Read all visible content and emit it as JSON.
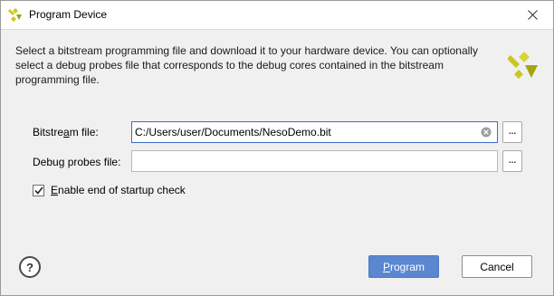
{
  "window": {
    "title": "Program Device",
    "brand_color": "#c8c81e"
  },
  "description": "Select a bitstream programming file and download it to your hardware device. You can optionally select a debug probes file that corresponds to the debug cores contained in the bitstream programming file.",
  "form": {
    "bitstream_label_pre": "Bitstre",
    "bitstream_label_mn": "a",
    "bitstream_label_post": "m file:",
    "bitstream_value": "C:/Users/user/Documents/NesoDemo.bit",
    "debug_label_pre": "Debu",
    "debug_label_mn": "g",
    "debug_label_post": " probes file:",
    "debug_value": "",
    "browse_label": "...",
    "checkbox_label_mn": "E",
    "checkbox_label_post": "nable end of startup check",
    "checkbox_checked": true
  },
  "footer": {
    "help_label": "?",
    "program_label_mn": "P",
    "program_label_post": "rogram",
    "cancel_label": "Cancel"
  },
  "colors": {
    "primary_button": "#5b86d0",
    "focus_border": "#3a6fc4"
  }
}
